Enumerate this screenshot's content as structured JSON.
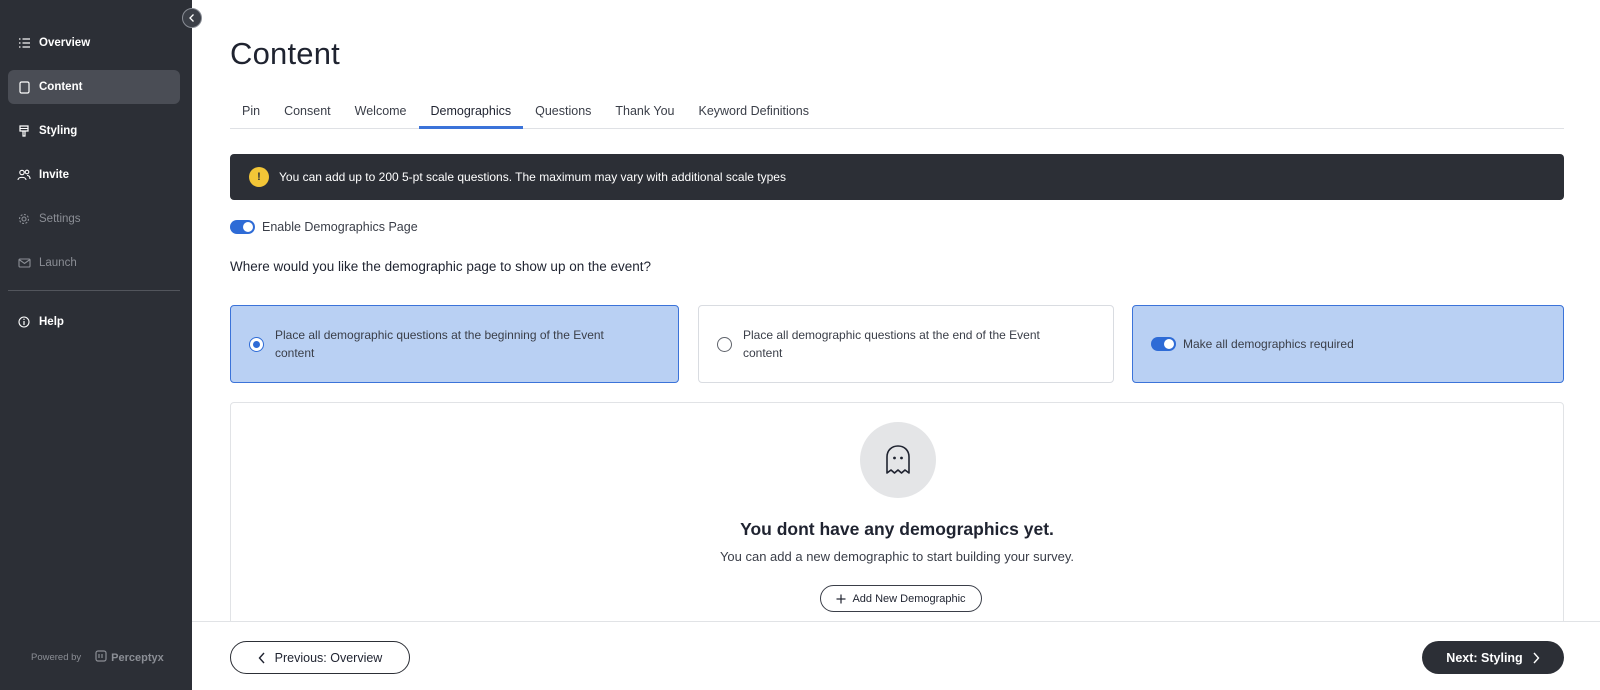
{
  "sidebar": {
    "items": [
      {
        "label": "Overview",
        "icon": "list-icon"
      },
      {
        "label": "Content",
        "icon": "document-icon"
      },
      {
        "label": "Styling",
        "icon": "brush-icon"
      },
      {
        "label": "Invite",
        "icon": "users-icon"
      },
      {
        "label": "Settings",
        "icon": "gear-icon"
      },
      {
        "label": "Launch",
        "icon": "mail-icon"
      }
    ],
    "help_label": "Help",
    "powered_by": "Powered by",
    "brand": "Perceptyx"
  },
  "page": {
    "title": "Content"
  },
  "tabs": [
    "Pin",
    "Consent",
    "Welcome",
    "Demographics",
    "Questions",
    "Thank You",
    "Keyword Definitions"
  ],
  "active_tab": "Demographics",
  "alert": {
    "icon_text": "!",
    "message": "You can add up to 200 5-pt scale questions. The maximum may vary with additional scale types"
  },
  "enable_toggle": {
    "label": "Enable Demographics Page",
    "on": true
  },
  "question": "Where would you like the demographic page to show up on the event?",
  "options": {
    "beginning": "Place all demographic questions at the beginning of the Event content",
    "end": "Place all demographic questions at the end of the Event content",
    "required": "Make all demographics required",
    "selected": "beginning"
  },
  "empty_state": {
    "title": "You dont have any demographics yet.",
    "subtitle": "You can add a new demographic to start building your survey.",
    "add_button": "Add New Demographic"
  },
  "footer": {
    "prev": "Previous: Overview",
    "next": "Next: Styling"
  },
  "colors": {
    "sidebar_bg": "#2c2f36",
    "accent": "#2e6bd6",
    "selected_card": "#b9d0f3",
    "warning": "#f3c637"
  }
}
